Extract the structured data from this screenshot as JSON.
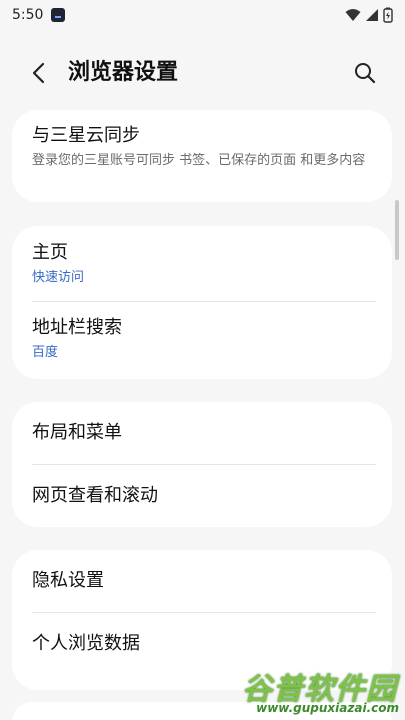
{
  "status_bar": {
    "time": "5:50"
  },
  "header": {
    "title": "浏览器设置"
  },
  "cards": [
    {
      "rows": [
        {
          "title": "与三星云同步",
          "subtitle": "登录您的三星账号可同步 书签、已保存的页面 和更多内容"
        }
      ]
    },
    {
      "rows": [
        {
          "title": "主页",
          "subtitle": "快速访问"
        },
        {
          "title": "地址栏搜索",
          "subtitle": "百度"
        }
      ]
    },
    {
      "rows": [
        {
          "title": "布局和菜单"
        },
        {
          "title": "网页查看和滚动"
        }
      ]
    },
    {
      "rows": [
        {
          "title": "隐私设置"
        },
        {
          "title": "个人浏览数据"
        }
      ]
    }
  ],
  "watermark": {
    "title": "谷普软件园",
    "url": "www.gupuxiazai.com"
  },
  "colors": {
    "accent_blue": "#3769c8",
    "background": "#f6f6f6",
    "card": "#ffffff"
  }
}
